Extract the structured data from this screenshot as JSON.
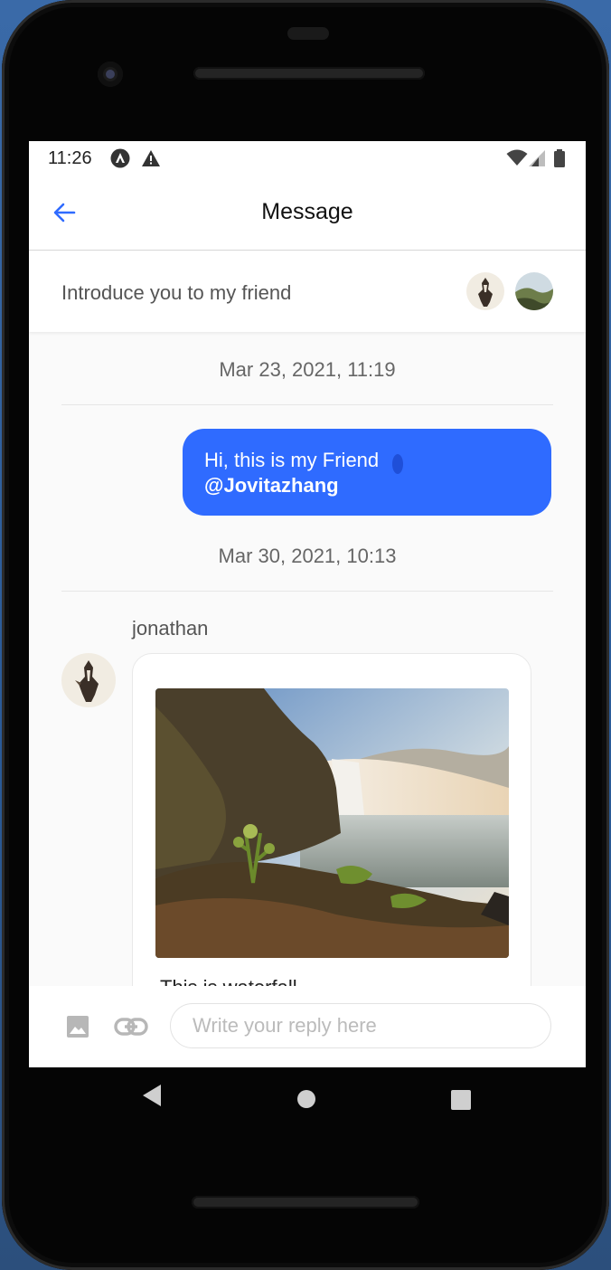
{
  "status": {
    "time": "11:26"
  },
  "appbar": {
    "title": "Message"
  },
  "conversation": {
    "subject": "Introduce you to my friend"
  },
  "messages": {
    "date1": "Mar 23, 2021, 11:19",
    "outgoing_text": "Hi, this is my Friend",
    "outgoing_mention": "@Jovitazhang",
    "date2": "Mar 30, 2021, 10:13",
    "sender": "jonathan",
    "card_caption": "This is waterfall"
  },
  "composer": {
    "placeholder": "Write your reply here"
  },
  "colors": {
    "accent": "#2f6bff",
    "back_arrow": "#2f6bff"
  }
}
